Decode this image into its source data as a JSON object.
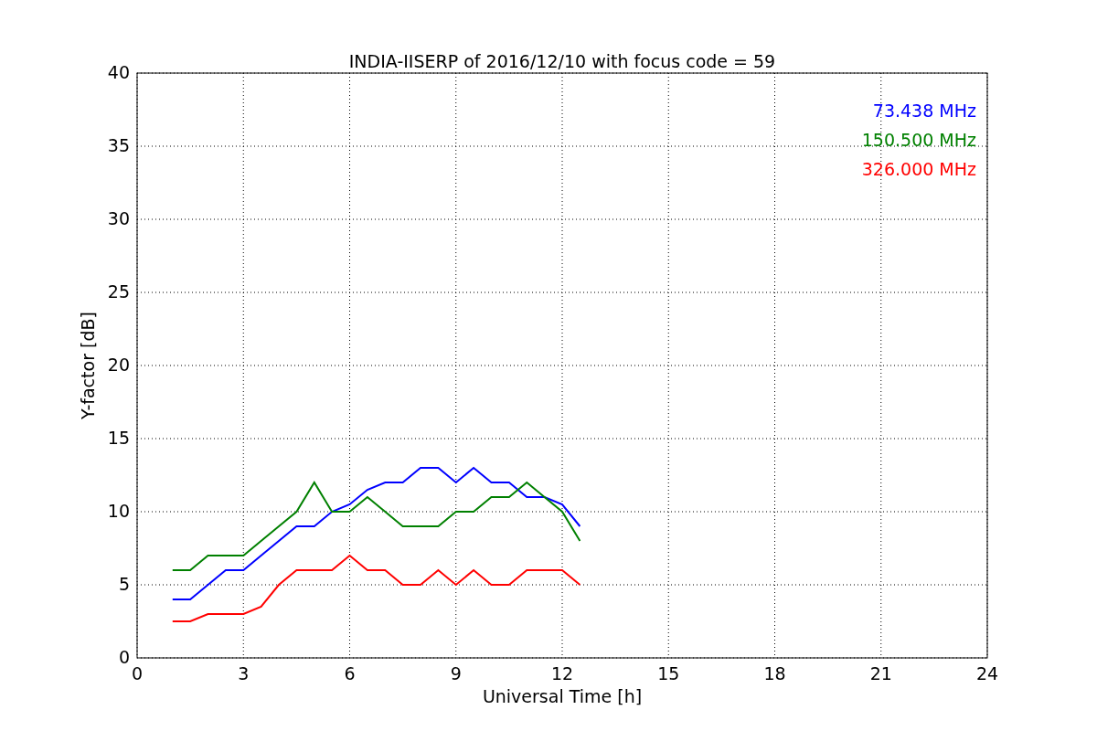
{
  "chart_data": {
    "type": "line",
    "title": "INDIA-IISERP of 2016/12/10 with focus code = 59",
    "xlabel": "Universal Time [h]",
    "ylabel": "Y-factor [dB]",
    "grid": true,
    "xlim": [
      0,
      24
    ],
    "ylim": [
      0,
      40
    ],
    "xticks": [
      0,
      3,
      6,
      9,
      12,
      15,
      18,
      21,
      24
    ],
    "yticks": [
      0,
      5,
      10,
      15,
      20,
      25,
      30,
      35,
      40
    ],
    "x": [
      1,
      1.5,
      2,
      2.5,
      3,
      3.5,
      4,
      4.5,
      5,
      5.5,
      6,
      6.5,
      7,
      7.5,
      8,
      8.5,
      9,
      9.5,
      10,
      10.5,
      11,
      11.5,
      12,
      12.5
    ],
    "series": [
      {
        "name": "73.438 MHz",
        "color": "#0000ff",
        "values": [
          4,
          4,
          5,
          6,
          6,
          7,
          8,
          9,
          9,
          10,
          10.5,
          11.5,
          12,
          12,
          13,
          13,
          12,
          13,
          12,
          12,
          11,
          11,
          10.5,
          9
        ]
      },
      {
        "name": "150.500 MHz",
        "color": "#008000",
        "values": [
          6,
          6,
          7,
          7,
          7,
          8,
          9,
          10,
          12,
          10,
          10,
          11,
          10,
          9,
          9,
          9,
          10,
          10,
          11,
          11,
          12,
          11,
          10,
          8
        ]
      },
      {
        "name": "326.000 MHz",
        "color": "#ff0000",
        "values": [
          2.5,
          2.5,
          3,
          3,
          3,
          3.5,
          5,
          6,
          6,
          6,
          7,
          6,
          6,
          5,
          5,
          6,
          5,
          6,
          5,
          5,
          6,
          6,
          6,
          5
        ]
      }
    ]
  }
}
